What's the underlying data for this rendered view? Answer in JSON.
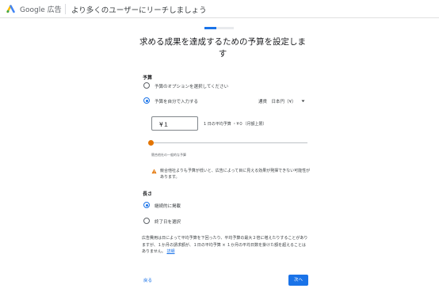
{
  "header": {
    "brand": "Google 広告",
    "page_title": "より多くのユーザーにリーチしましょう"
  },
  "progress": {
    "fraction": 0.4,
    "accent": "#1a73e8"
  },
  "main": {
    "title": "求める成果を達成するための予算を設定します",
    "budget_section": {
      "label": "予算",
      "option_choose": "予算のオプションを選択してください",
      "option_manual": "予算を自分で入力する",
      "selected": "option_manual",
      "currency": "通貨　日本円（¥）",
      "currency_icon": "caret-down-icon",
      "amount_value": "¥１",
      "amount_info": "1 日の平均予算 ・¥０（月額上限）",
      "slider_caption": "競合他社の一般的な予算",
      "slider_level": 0.0,
      "warning_icon": "warning-icon",
      "warning_color": "#e37400",
      "warning_text": "競合他社よりも予算が低いと、広告によって目に見える効果が発揮できない可能性があります。"
    },
    "duration_section": {
      "label": "長さ",
      "option_continuous": "継続的に掲載",
      "option_end_date": "終了日を選択",
      "selected": "option_continuous"
    },
    "help_text": "広告費用は日によって平均予算を下回ったり、平均予算の最大２倍に増えたりすることがありますが、１か月の請求額が、１日の平均予算 × １か月の平均日数を掛けた額を超えることはありません。",
    "help_link": "詳細"
  },
  "footer": {
    "back_label": "戻る",
    "next_label": "次へ"
  }
}
